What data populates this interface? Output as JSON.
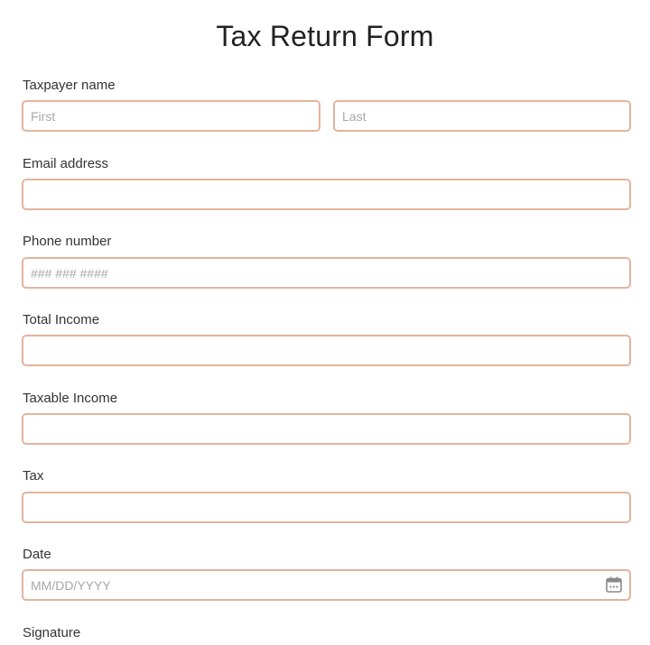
{
  "form": {
    "title": "Tax Return Form",
    "taxpayer_name": {
      "label": "Taxpayer name",
      "first_placeholder": "First",
      "last_placeholder": "Last"
    },
    "email": {
      "label": "Email address",
      "placeholder": ""
    },
    "phone": {
      "label": "Phone number",
      "placeholder": "### ### ####"
    },
    "total_income": {
      "label": "Total Income",
      "placeholder": ""
    },
    "taxable_income": {
      "label": "Taxable Income",
      "placeholder": ""
    },
    "tax": {
      "label": "Tax",
      "placeholder": ""
    },
    "date": {
      "label": "Date",
      "placeholder": "MM/DD/YYYY",
      "icon": "calendar-icon"
    },
    "signature": {
      "label": "Signature"
    }
  },
  "colors": {
    "field_border": "#e3b49c",
    "placeholder": "#a8a8a8"
  }
}
